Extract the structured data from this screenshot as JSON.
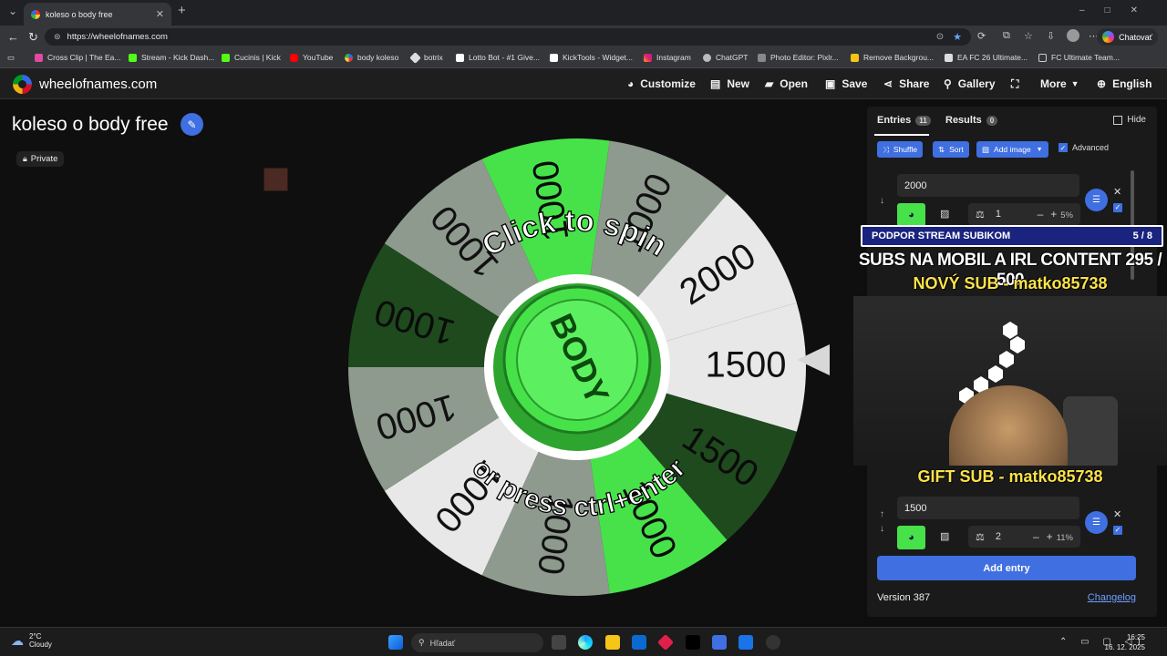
{
  "browser": {
    "tab_title": "koleso o body free",
    "url": "https://wheelofnames.com",
    "chat_label": "Chatovať",
    "bookmarks": [
      "Cross Clip | The Ea...",
      "Stream - Kick Dash...",
      "Cucinis | Kick",
      "YouTube",
      "body koleso",
      "botrix",
      "Lotto Bot - #1 Give...",
      "KickTools - Widget...",
      "Instagram",
      "ChatGPT",
      "Photo Editor: Pixlr...",
      "Remove Backgrou...",
      "EA FC 26 Ultimate...",
      "FC Ultimate Team..."
    ]
  },
  "site": {
    "logo": "wheelofnames.com",
    "nav": {
      "customize": "Customize",
      "new": "New",
      "open": "Open",
      "save": "Save",
      "share": "Share",
      "gallery": "Gallery",
      "more": "More",
      "language": "English"
    }
  },
  "main": {
    "title": "koleso o body free",
    "private_label": "Private",
    "wheel": {
      "click_text": "Click to spin",
      "press_text": "or press ctrl+enter",
      "center_text": "BODY",
      "segments": [
        "1500",
        "1500",
        "1000",
        "1000",
        "1000",
        "1000",
        "1000",
        "1000",
        "1000",
        "1000",
        "2000"
      ]
    }
  },
  "sidebar": {
    "tab_entries": "Entries",
    "entries_count": "11",
    "tab_results": "Results",
    "results_count": "0",
    "hide_label": "Hide",
    "shuffle": "Shuffle",
    "sort": "Sort",
    "add_image": "Add image",
    "advanced": "Advanced",
    "entries": [
      {
        "value": "2000",
        "weight": "1",
        "percent": "5%"
      },
      {
        "value": "1500",
        "weight": "2",
        "percent": "11%"
      }
    ],
    "add_entry": "Add entry",
    "version": "Version 387",
    "changelog": "Changelog"
  },
  "overlay": {
    "support_title": "PODPOR STREAM SUBIKOM",
    "support_count": "5 / 8",
    "sub_goal": "SUBS NA MOBIL A IRL CONTENT",
    "sub_goal_count": "295 / 500",
    "new_sub": "NOVÝ SUB - matko85738",
    "gift_sub": "GIFT SUB - matko85738"
  },
  "taskbar": {
    "temp": "2°C",
    "weather": "Cloudy",
    "search_placeholder": "Hľadať",
    "time": "16:25",
    "date": "16. 12. 2025"
  },
  "colors": {
    "accent": "#3f6fe0",
    "entry_color": "#47e24a",
    "wheel_green": "#47e24a",
    "wheel_dark": "#1e4a1e",
    "wheel_gray": "#8f9a8f",
    "wheel_white": "#e8e8e8"
  }
}
